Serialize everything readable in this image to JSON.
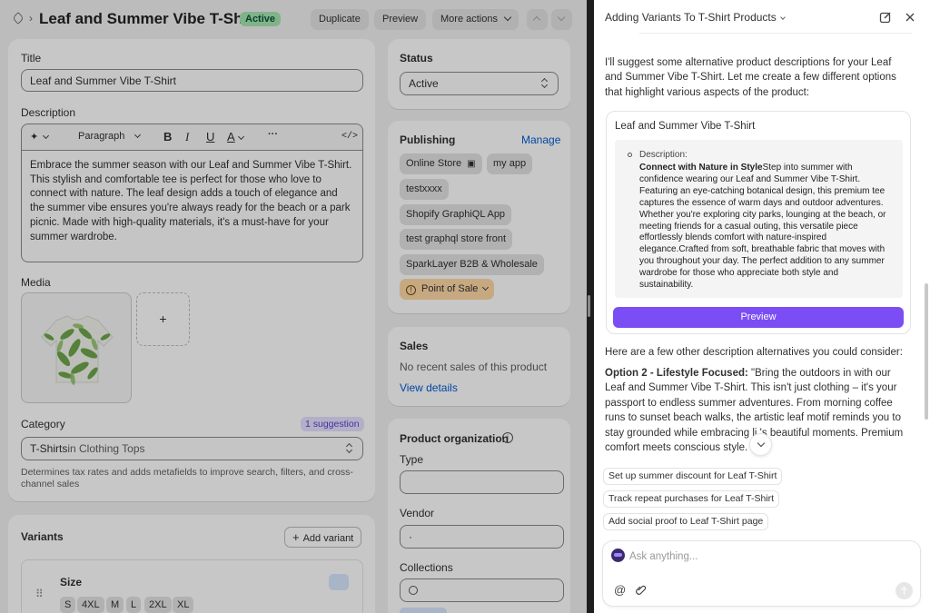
{
  "topbar": {
    "title": "Leaf and Summer Vibe T-Shirt",
    "status_badge": "Active",
    "duplicate_label": "Duplicate",
    "preview_label": "Preview",
    "more_actions_label": "More actions",
    "breadcrumb_separator": "›"
  },
  "title_section": {
    "label": "Title",
    "value": "Leaf and Summer Vibe T-Shirt"
  },
  "description_section": {
    "label": "Description",
    "format_select": "Paragraph",
    "toolbar": {
      "bold": "B",
      "italic": "I",
      "underline": "U",
      "text_color": "A",
      "more": "···",
      "code": "</>"
    },
    "body": "Embrace the summer season with our Leaf and Summer Vibe T-Shirt. This stylish and comfortable tee is perfect for those who love to connect with nature. The leaf design adds a touch of elegance and the summer vibe ensures you're always ready for the beach or a park picnic. Made with high-quality materials, it's a must-have for your summer wardrobe."
  },
  "media_section": {
    "label": "Media",
    "add_symbol": "+"
  },
  "category_section": {
    "label": "Category",
    "suggestion_badge": "1 suggestion",
    "value_main": "T-Shirts",
    "value_sub": " in Clothing Tops",
    "help_text": "Determines tax rates and adds metafields to improve search, filters, and cross-channel sales"
  },
  "variants_section": {
    "label": "Variants",
    "add_variant_label": "Add variant",
    "option_name": "Size",
    "option_values": [
      "S",
      "4XL",
      "M",
      "L",
      "2XL",
      "XL"
    ]
  },
  "status_card": {
    "label": "Status",
    "value": "Active"
  },
  "publishing_card": {
    "label": "Publishing",
    "manage_link": "Manage",
    "channels": [
      "Online Store",
      "my app",
      "testxxxx",
      "Shopify GraphiQL App",
      "test graphql store front",
      "SparkLayer B2B & Wholesale",
      "Point of Sale"
    ]
  },
  "sales_card": {
    "label": "Sales",
    "text": "No recent sales of this product",
    "link": "View details"
  },
  "organization_card": {
    "label": "Product organization",
    "type_label": "Type",
    "vendor_label": "Vendor",
    "vendor_value": "·",
    "collections_label": "Collections"
  },
  "assistant": {
    "title": "Adding Variants To T-Shirt Products",
    "intro": "I'll suggest some alternative product descriptions for your Leaf and Summer Vibe T-Shirt. Let me create a few different options that highlight various aspects of the product:",
    "card": {
      "title": "Leaf and Summer Vibe T-Shirt",
      "description_label": "Description:",
      "description_lead": "Connect with Nature in Style",
      "description_body": "Step into summer with confidence wearing our Leaf and Summer Vibe T-Shirt. Featuring an eye-catching botanical design, this premium tee captures the essence of warm days and outdoor adventures. Whether you're exploring city parks, lounging at the beach, or meeting friends for a casual outing, this versatile piece effortlessly blends comfort with nature-inspired elegance.Crafted from soft, breathable fabric that moves with you throughout your day. The perfect addition to any summer wardrobe for those who appreciate both style and sustainability.",
      "preview_label": "Preview"
    },
    "alternatives_intro": "Here are a few other description alternatives you could consider:",
    "option2_heading": "Option 2 - Lifestyle Focused:",
    "option2_text": " \"Bring the outdoors in with our Leaf and Summer Vibe T-Shirt. This isn't just clothing – it's your passport to endless summer adventures. From morning coffee runs to sunset beach walks, the artistic leaf motif reminds you to stay grounded while embracing li  's beautiful moments. Premium comfort meets conscious style.",
    "suggestions": [
      "Set up summer discount for Leaf T-Shirt",
      "Track repeat purchases for Leaf T-Shirt",
      "Add social proof to Leaf T-Shirt page"
    ],
    "input_placeholder": "Ask anything..."
  },
  "colors": {
    "accent_purple": "#7b4df4",
    "active_badge_bg": "#a6e6b3",
    "link_blue": "#005bd3",
    "pos_pill_bg": "#ffd9a6"
  }
}
